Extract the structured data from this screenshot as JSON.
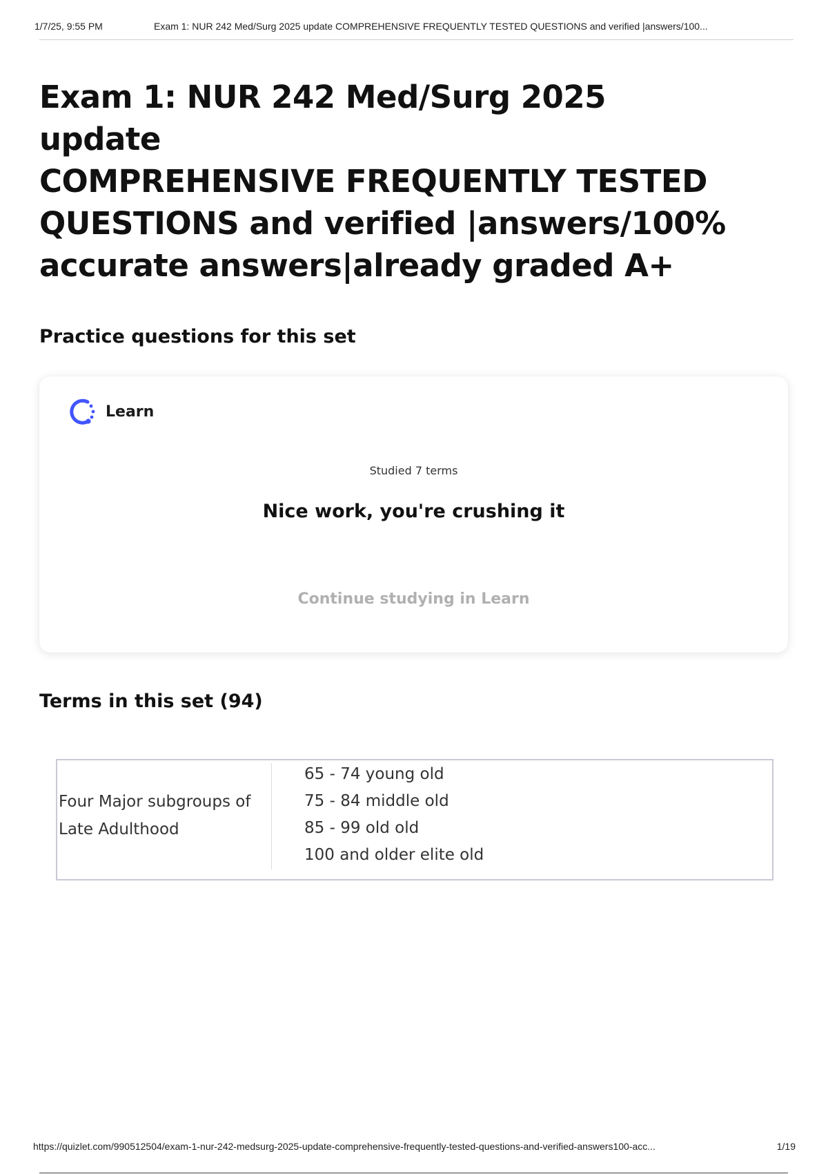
{
  "print_header": {
    "datetime": "1/7/25, 9:55 PM",
    "title": "Exam 1: NUR 242 Med/Surg 2025 update COMPREHENSIVE FREQUENTLY TESTED QUESTIONS and verified |answers/100..."
  },
  "page": {
    "title_lines": [
      "Exam 1: NUR 242 Med/Surg 2025 update",
      "COMPREHENSIVE FREQUENTLY TESTED",
      "QUESTIONS and verified |answers/100%",
      "accurate answers|already graded A+"
    ]
  },
  "practice": {
    "heading": "Practice questions for this set",
    "card": {
      "icon": "learn-progress-icon",
      "label": "Learn",
      "studied": "Studied 7 terms",
      "message": "Nice work, you're crushing it",
      "button_label": "Continue studying in Learn"
    }
  },
  "terms": {
    "heading": "Terms in this set (94)",
    "items": [
      {
        "term_lines": [
          "Four Major subgroups of",
          "Late Adulthood"
        ],
        "definition_lines": [
          "65 - 74 young old",
          "75 - 84 middle old",
          "85 - 99 old old",
          "100 and older elite old"
        ]
      }
    ]
  },
  "print_footer": {
    "url": "https://quizlet.com/990512504/exam-1-nur-242-medsurg-2025-update-comprehensive-frequently-tested-questions-and-verified-answers100-acc...",
    "page": "1/19"
  },
  "colors": {
    "learn_icon_accent": "#4255ff",
    "continue_text": "#b0b0b0",
    "table_border": "#c9c9d6"
  }
}
